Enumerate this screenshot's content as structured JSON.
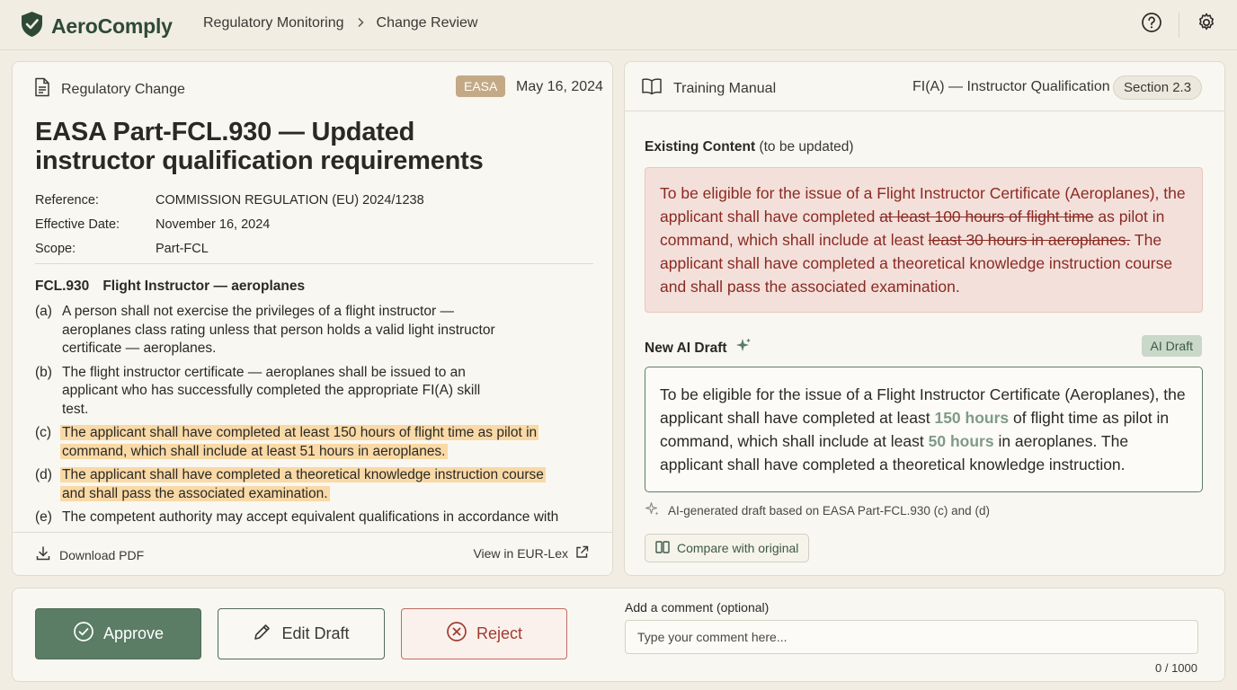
{
  "app": {
    "name": "AeroComply"
  },
  "breadcrumb": {
    "items": [
      "Regulatory Monitoring",
      "Change Review"
    ]
  },
  "icons": {
    "logo": "shield-check-icon",
    "help": "question-circle-icon",
    "settings": "gear-icon",
    "document": "document-icon",
    "book": "open-book-icon",
    "download": "download-icon",
    "external": "external-link-icon",
    "sparkle": "sparkle-icon",
    "compare": "columns-icon",
    "approve": "check-circle-icon",
    "edit": "pencil-icon",
    "reject": "x-circle-icon"
  },
  "colors": {
    "brand": "#2e4a37",
    "approve": "#5b7d65",
    "reject": "#a23a32",
    "highlight": "#f9d9a6",
    "existing_bg": "#f4e0db"
  },
  "left_panel": {
    "header": "Regulatory Change",
    "badge": "EASA",
    "date": "May 16, 2024",
    "title": "EASA Part-FCL.930 — Updated instructor qualification requirements",
    "meta": [
      {
        "label": "Reference:",
        "value": "COMMISSION REGULATION (EU) 2024/1238"
      },
      {
        "label": "Effective Date:",
        "value": "November 16, 2024"
      },
      {
        "label": "Scope:",
        "value": "Part-FCL"
      }
    ],
    "section_code": "FCL.930",
    "section_title": "Flight Instructor — aeroplanes",
    "clauses": [
      {
        "n": "(a)",
        "text": "A person shall not exercise the privileges of a flight instructor — aeroplanes class rating unless that person holds a valid light instructor certificate — aeroplanes.",
        "highlighted": false
      },
      {
        "n": "(b)",
        "text": "The flight instructor certificate — aeroplanes shall be issued to an applicant who has successfully completed the appropriate FI(A) skill test.",
        "highlighted": false
      },
      {
        "n": "(c)",
        "text": "The applicant shall have completed at least 150 hours of flight time as pilot in command, which shall include at least 51 hours in aeroplanes.",
        "highlighted": true
      },
      {
        "n": "(d)",
        "text": "The applicant shall have completed a theoretical knowledge instruction course and shall pass the associated examination.",
        "highlighted": true
      },
      {
        "n": "(e)",
        "text": "The competent authority may accept equivalent qualifications in accordance with",
        "highlighted": false
      }
    ],
    "download_label": "Download PDF",
    "view_label": "View in EUR-Lex"
  },
  "right_panel": {
    "header": "Training Manual",
    "doc_title": "FI(A) — Instructor Qualification",
    "section": "Section 2.3",
    "existing_label": "Existing Content",
    "existing_note": "(to be updated)",
    "existing_text": {
      "p1": "To be eligible for the issue of a Flight Instructor Certificate (Aeroplanes), the applicant shall have completed ",
      "s1": "at least 100 hours of flight time",
      "p2": " as pilot in command, which shall include at least ",
      "s2": "least 30 hours in aeroplanes.",
      "p3": " The applicant shall have completed a theoretical knowledge instruction course and shall pass the associated examination."
    },
    "ai_label": "New AI Draft",
    "ai_badge": "AI Draft",
    "ai_text": {
      "p1": "To be eligible for the issue of a Flight Instructor Certificate (Aeroplanes), the applicant shall have completed at least ",
      "h1": "150 hours",
      "p2": " of flight time as pilot in command, which shall include at least ",
      "h2": "50 hours",
      "p3": " in aeroplanes. The applicant shall have completed a theoretical knowledge instruction."
    },
    "ai_note": "AI-generated draft based on EASA Part-FCL.930 (c) and (d)",
    "compare_label": "Compare with original"
  },
  "actions": {
    "approve": "Approve",
    "edit": "Edit Draft",
    "reject": "Reject",
    "comment_label": "Add a comment (optional)",
    "comment_placeholder": "Type your comment here...",
    "comment_value": "",
    "comment_count": "0 / 1000"
  }
}
